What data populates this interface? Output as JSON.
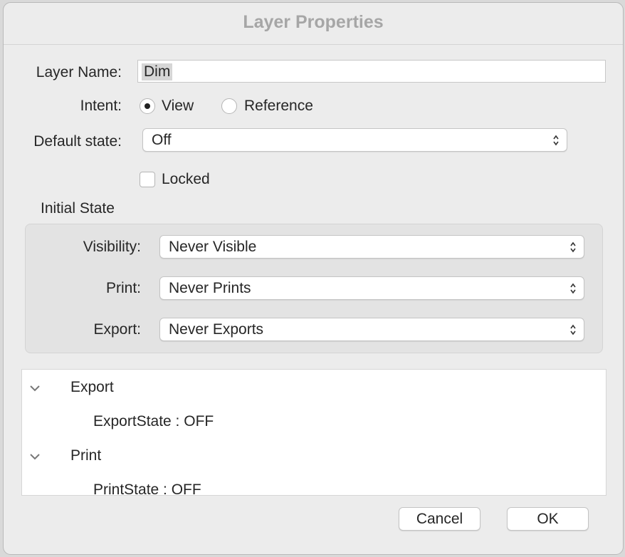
{
  "dialog": {
    "title": "Layer Properties"
  },
  "form": {
    "layer_name_label": "Layer Name:",
    "layer_name_value": "Dim",
    "intent_label": "Intent:",
    "intent_options": [
      {
        "label": "View",
        "selected": true
      },
      {
        "label": "Reference",
        "selected": false
      }
    ],
    "default_state_label": "Default state:",
    "default_state_value": "Off",
    "locked_label": "Locked",
    "locked_checked": false
  },
  "initial_state": {
    "title": "Initial State",
    "visibility_label": "Visibility:",
    "visibility_value": "Never Visible",
    "print_label": "Print:",
    "print_value": "Never Prints",
    "export_label": "Export:",
    "export_value": "Never Exports"
  },
  "outline": {
    "items": [
      {
        "title": "Export",
        "child": "ExportState : OFF",
        "expanded": true
      },
      {
        "title": "Print",
        "child": "PrintState : OFF",
        "expanded": true
      }
    ]
  },
  "buttons": {
    "cancel": "Cancel",
    "ok": "OK"
  },
  "icons": {
    "popup_arrows": "updown-chevron-icon",
    "disclosure": "chevron-down-icon"
  },
  "colors": {
    "window_bg": "#ececec",
    "title_text": "#a6a6a6",
    "group_bg": "#e3e3e3",
    "selection": "#d6d6d6"
  }
}
